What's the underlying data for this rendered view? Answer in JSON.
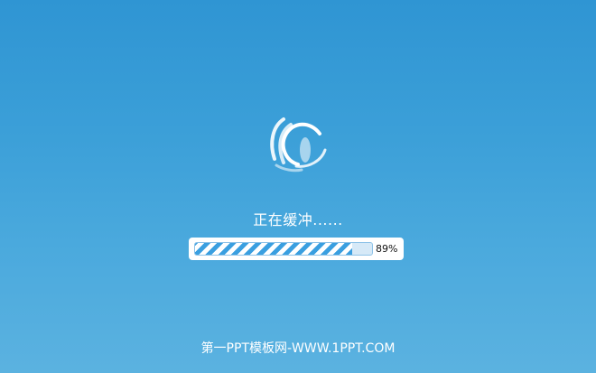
{
  "status": {
    "text": "正在缓冲......"
  },
  "progress": {
    "value": 0.89,
    "label": "89%",
    "fill_color": "#3a9fe0"
  },
  "footer": {
    "text": "第一PPT模板网-WWW.1PPT.COM"
  },
  "logo": {
    "icon": "swirl-eye-logo-icon"
  },
  "colors": {
    "background_top": "#2f95d3",
    "background_bottom": "#5bb2e0",
    "text": "#ffffff"
  }
}
